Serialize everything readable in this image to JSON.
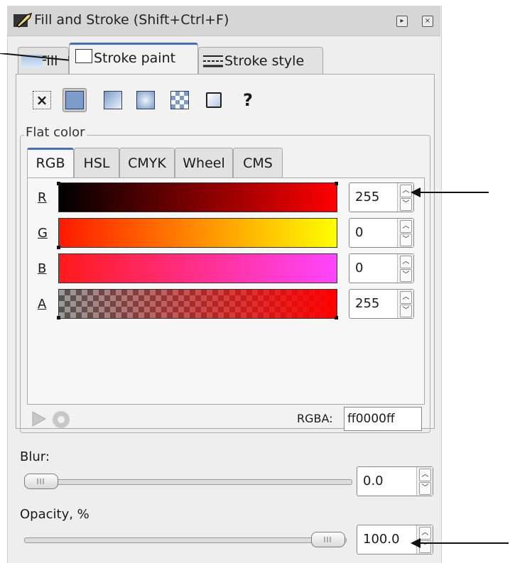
{
  "window": {
    "title": "Fill and Stroke (Shift+Ctrl+F)"
  },
  "tabs": [
    {
      "label": "Fill"
    },
    {
      "label": "Stroke paint",
      "active": true
    },
    {
      "label": "Stroke style"
    }
  ],
  "paint_modes": [
    "no-paint",
    "flat-color",
    "linear-gradient",
    "radial-gradient",
    "pattern",
    "swatch",
    "unset"
  ],
  "paint_mode_glyphs": {
    "no_paint": "×",
    "unset": "?"
  },
  "flat_color": {
    "section_label": "Flat color",
    "tabs": [
      "RGB",
      "HSL",
      "CMYK",
      "Wheel",
      "CMS"
    ],
    "active_tab": "RGB",
    "channels": [
      {
        "label": "R",
        "value": "255"
      },
      {
        "label": "G",
        "value": "0"
      },
      {
        "label": "B",
        "value": "0"
      },
      {
        "label": "A",
        "value": "255"
      }
    ],
    "rgba_label": "RGBA:",
    "rgba_value": "ff0000ff"
  },
  "blur": {
    "label": "Blur:",
    "value": "0.0"
  },
  "opacity": {
    "label": "Opacity, %",
    "value": "100.0"
  },
  "colors": {
    "tab_accent": "#4a6fb0",
    "red": "#ff0000"
  }
}
